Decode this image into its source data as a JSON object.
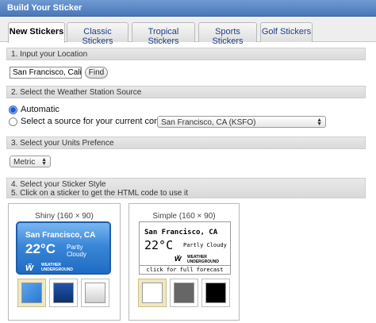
{
  "window": {
    "title": "Build Your Sticker"
  },
  "tabs": [
    {
      "label": "New Stickers",
      "active": true
    },
    {
      "label": "Classic Stickers",
      "active": false
    },
    {
      "label": "Tropical Stickers",
      "active": false
    },
    {
      "label": "Sports Stickers",
      "active": false
    },
    {
      "label": "Golf Stickers",
      "active": false
    }
  ],
  "step1": {
    "heading": "1. Input your Location",
    "location_value": "San Francisco, Califor",
    "find_label": "Find"
  },
  "step2": {
    "heading": "2. Select the Weather Station Source",
    "automatic_label": "Automatic",
    "select_source_label": "Select a source for your current conditions:",
    "source_selected": "San Francisco, CA (KSFO)",
    "selected_option": "automatic"
  },
  "step3": {
    "heading": "3. Select your Units Prefence",
    "units_selected": "Metric"
  },
  "step45": {
    "heading_line1": "4. Select your Sticker Style",
    "heading_line2": "5. Click on a sticker to get the HTML code to use it"
  },
  "styles": {
    "shiny": {
      "title": "Shiny (160 × 90)",
      "city": "San Francisco, CA",
      "temp": "22°C",
      "condition": "Partly Cloudy",
      "brand_line1": "WEATHER",
      "brand_line2": "UNDERGROUND",
      "swatches": [
        {
          "color": "#3c8fe0",
          "selected": true
        },
        {
          "color": "#16408a",
          "selected": false
        },
        {
          "color": "#e8e8e8",
          "selected": false
        }
      ]
    },
    "simple": {
      "title": "Simple (160 × 90)",
      "city": "San Francisco, CA",
      "temp": "22°C",
      "condition": "Partly Cloudy",
      "brand_line1": "WEATHER",
      "brand_line2": "UNDERGROUND",
      "footer": "click for full forecast",
      "swatches": [
        {
          "color": "#ffffff",
          "selected": true
        },
        {
          "color": "#666666",
          "selected": false
        },
        {
          "color": "#000000",
          "selected": false
        }
      ]
    }
  }
}
